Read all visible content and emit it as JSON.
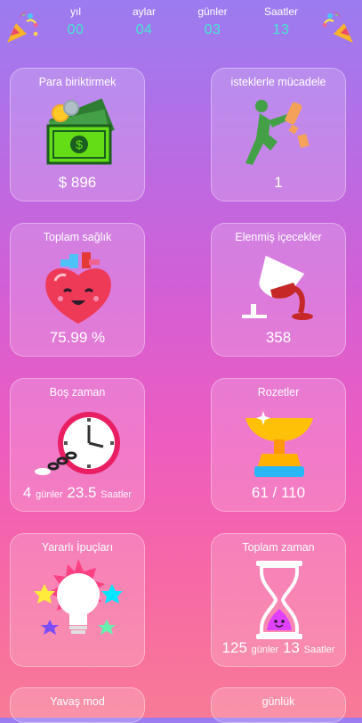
{
  "header": {
    "stats": [
      {
        "label": "yıl",
        "value": "00"
      },
      {
        "label": "aylar",
        "value": "04"
      },
      {
        "label": "günler",
        "value": "03"
      },
      {
        "label": "Saatler",
        "value": "13"
      }
    ]
  },
  "cards": {
    "savings": {
      "title": "Para biriktirmek",
      "value": "$ 896",
      "icon": "money-stack-icon"
    },
    "cravings": {
      "title": "isteklerle mücadele",
      "value": "1",
      "icon": "kick-bottle-icon"
    },
    "health": {
      "title": "Toplam sağlık",
      "value": "75.99 %",
      "icon": "happy-heart-icon"
    },
    "drinks": {
      "title": "Elenmiş içecekler",
      "value": "358",
      "icon": "spilled-glass-icon"
    },
    "free_time": {
      "title": "Boş zaman",
      "num1": "4",
      "unit1": "günler",
      "num2": "23.5",
      "unit2": "Saatler",
      "icon": "chained-clock-icon"
    },
    "badges": {
      "title": "Rozetler",
      "value": "61 / 110",
      "icon": "trophy-cup-icon"
    },
    "tips": {
      "title": "Yararlı İpuçları",
      "icon": "lightbulb-icon"
    },
    "total_time": {
      "title": "Toplam zaman",
      "num1": "125",
      "unit1": "günler",
      "num2": "13",
      "unit2": "Saatler",
      "icon": "hourglass-icon"
    },
    "slow_mode": {
      "title": "Yavaş mod"
    },
    "daily": {
      "title": "günlük"
    }
  },
  "colors": {
    "accent": "#46e6d2",
    "card_bg": "rgba(255,255,255,0.18)"
  }
}
